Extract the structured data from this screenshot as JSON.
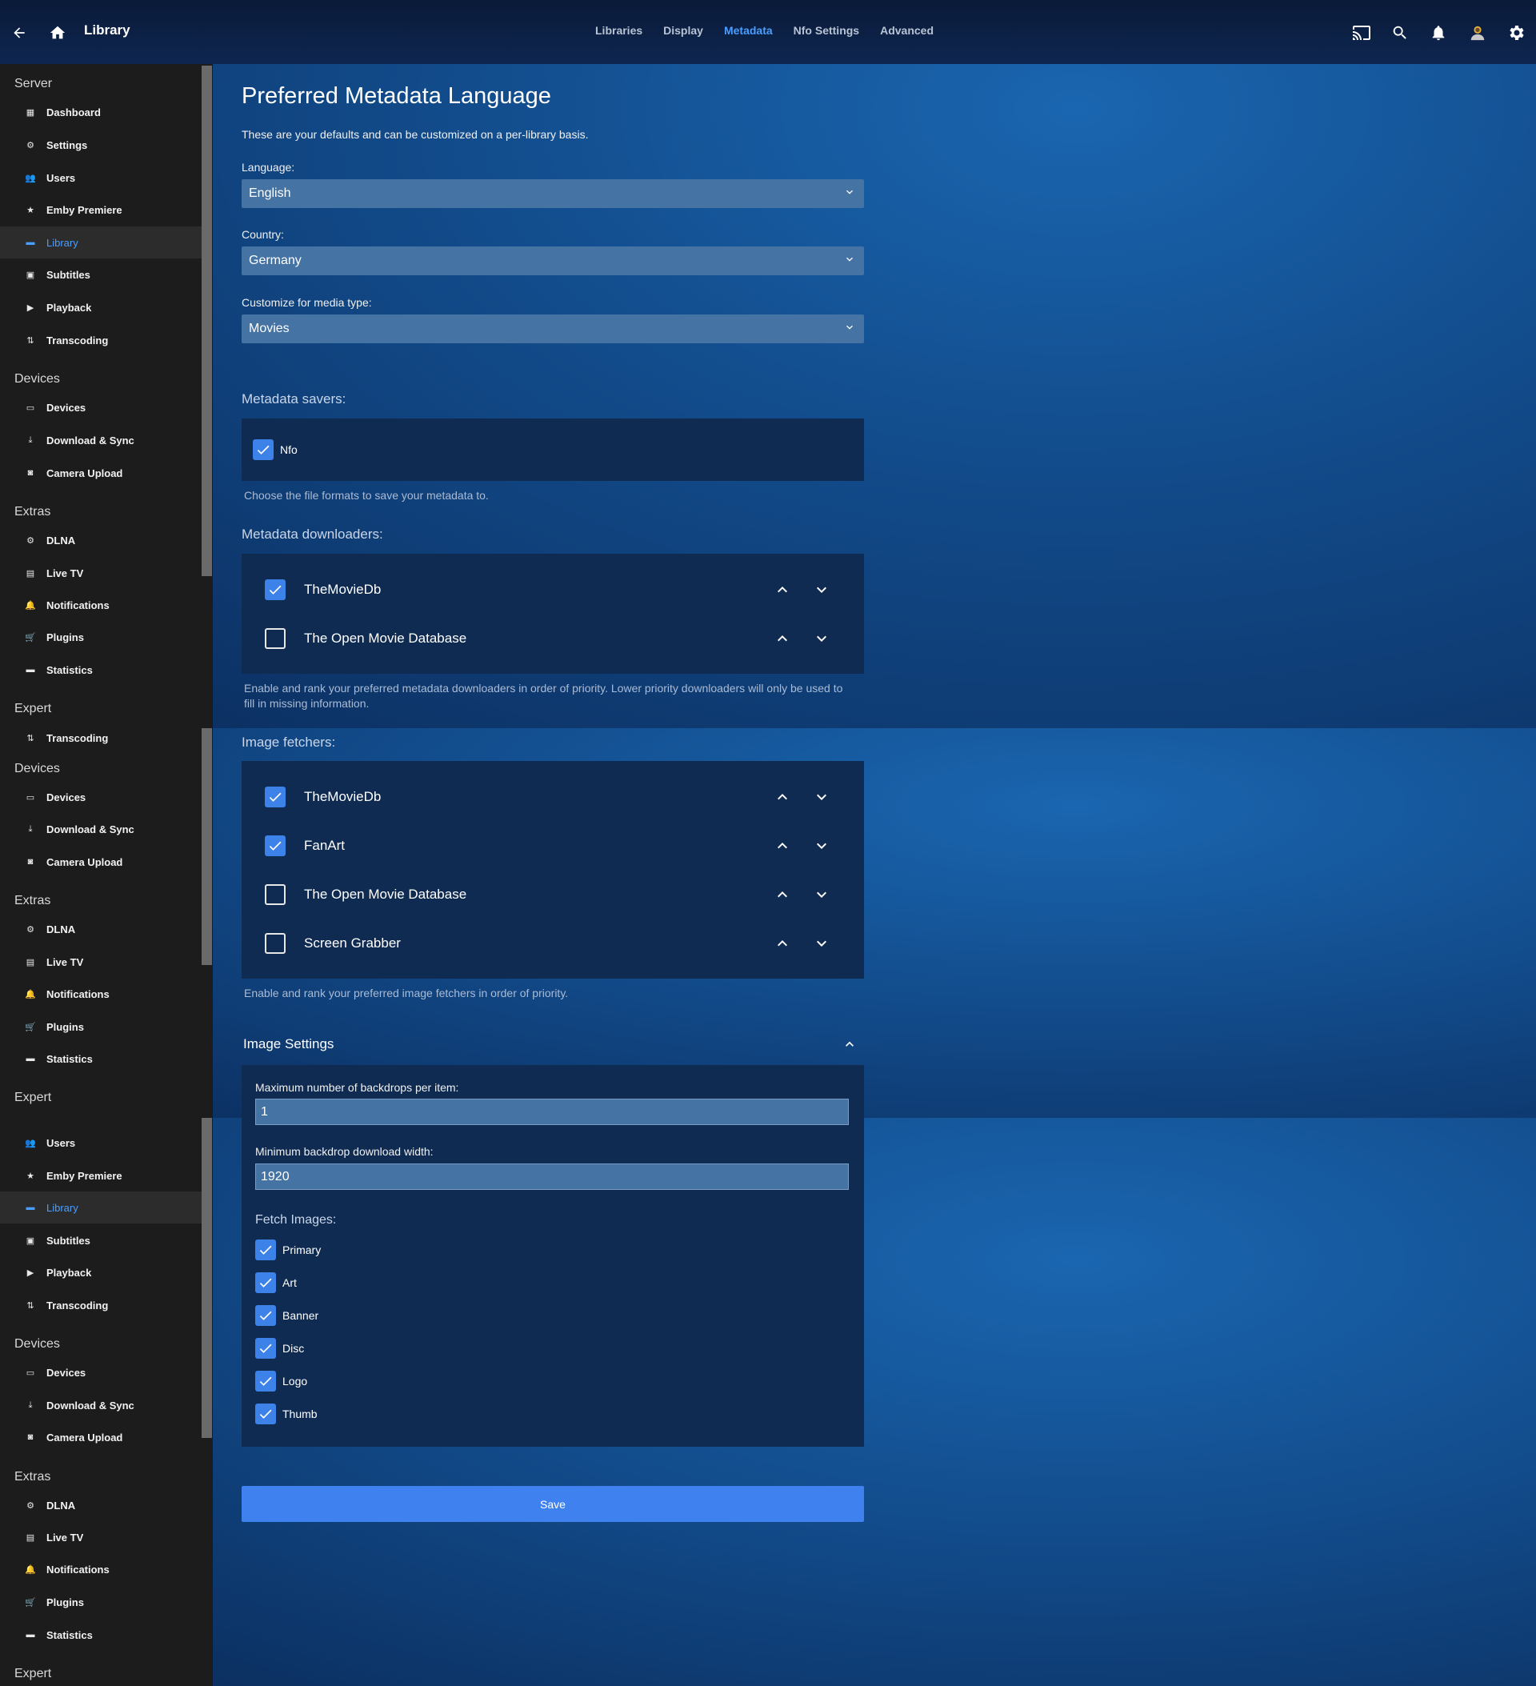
{
  "header": {
    "title": "Library",
    "tabs": [
      {
        "label": "Libraries",
        "active": false
      },
      {
        "label": "Display",
        "active": false
      },
      {
        "label": "Metadata",
        "active": true
      },
      {
        "label": "Nfo Settings",
        "active": false
      },
      {
        "label": "Advanced",
        "active": false
      }
    ],
    "icons": [
      "back-arrow-icon",
      "home-icon",
      "cast-icon",
      "search-icon",
      "bell-icon",
      "avatar",
      "gear-icon"
    ]
  },
  "sidebar": {
    "sections": [
      "Server",
      "Devices",
      "Extras",
      "Expert",
      "Devices",
      "Extras",
      "Expert",
      "Devices",
      "Extras",
      "Expert"
    ],
    "items": [
      "Dashboard",
      "Settings",
      "Users",
      "Emby Premiere",
      "Library",
      "Subtitles",
      "Playback",
      "Transcoding",
      "Devices",
      "Download & Sync",
      "Camera Upload",
      "DLNA",
      "Live TV",
      "Notifications",
      "Plugins",
      "Statistics",
      "Transcoding",
      "Devices",
      "Download & Sync",
      "Camera Upload",
      "DLNA",
      "Live TV",
      "Notifications",
      "Plugins",
      "Statistics",
      "Users",
      "Emby Premiere",
      "Library",
      "Subtitles",
      "Playback",
      "Transcoding",
      "Devices",
      "Download & Sync",
      "Camera Upload",
      "DLNA",
      "Live TV",
      "Notifications",
      "Plugins",
      "Statistics"
    ]
  },
  "main": {
    "title": "Preferred Metadata Language",
    "intro": "These are your defaults and can be customized on a per-library basis.",
    "language": {
      "label": "Language:",
      "value": "English"
    },
    "country": {
      "label": "Country:",
      "value": "Germany"
    },
    "media_type": {
      "label": "Customize for media type:",
      "value": "Movies"
    },
    "savers": {
      "title": "Metadata savers:",
      "items": [
        {
          "label": "Nfo",
          "checked": true
        }
      ],
      "hint": "Choose the file formats to save your metadata to."
    },
    "downloaders": {
      "title": "Metadata downloaders:",
      "items": [
        {
          "label": "TheMovieDb",
          "checked": true
        },
        {
          "label": "The Open Movie Database",
          "checked": false
        }
      ],
      "hint1": "Enable and rank your preferred metadata downloaders in order of priority. Lower priority downloaders will only be used to",
      "hint2": "fill in missing information."
    },
    "fetchers": {
      "title": "Image fetchers:",
      "items": [
        {
          "label": "TheMovieDb",
          "checked": true
        },
        {
          "label": "FanArt",
          "checked": true
        },
        {
          "label": "The Open Movie Database",
          "checked": false
        },
        {
          "label": "Screen Grabber",
          "checked": false
        }
      ],
      "hint": "Enable and rank your preferred image fetchers in order of priority."
    },
    "image_settings": {
      "title": "Image Settings",
      "max_backdrops_label": "Maximum number of backdrops per item:",
      "max_backdrops_value": "1",
      "min_width_label": "Minimum backdrop download width:",
      "min_width_value": "1920",
      "fetch_label": "Fetch Images:",
      "fetch_items": [
        {
          "label": "Primary",
          "checked": true
        },
        {
          "label": "Art",
          "checked": true
        },
        {
          "label": "Banner",
          "checked": true
        },
        {
          "label": "Disc",
          "checked": true
        },
        {
          "label": "Logo",
          "checked": true
        },
        {
          "label": "Thumb",
          "checked": true
        }
      ]
    },
    "save_label": "Save"
  },
  "colors": {
    "accent": "#3f82ef",
    "active_text": "#4a9eff",
    "panel": "#0f2b52",
    "sidebar": "#1c1c1c"
  }
}
